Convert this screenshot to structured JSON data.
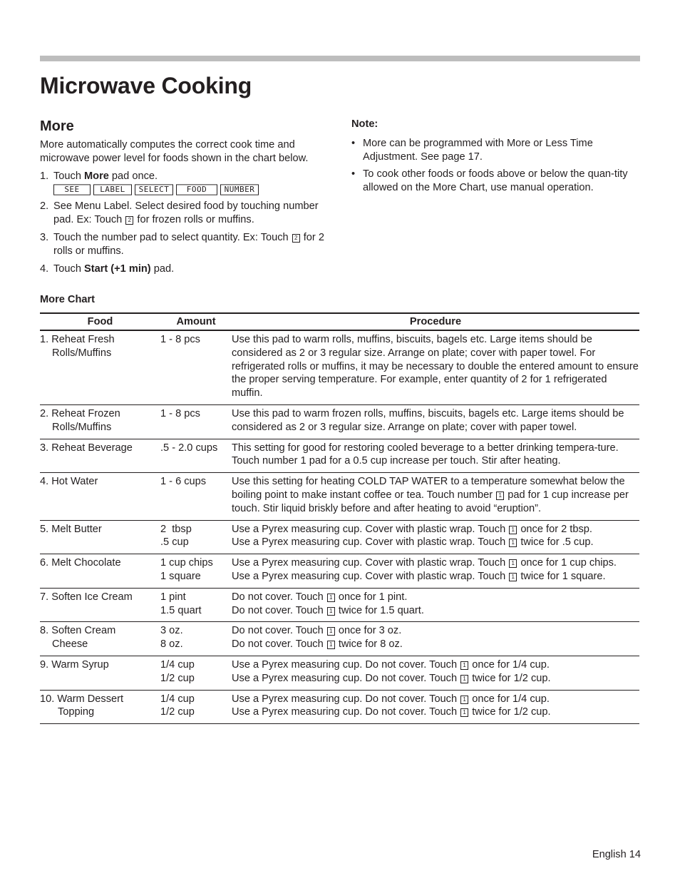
{
  "page": {
    "title": "Microwave Cooking",
    "footer": "English 14"
  },
  "more_section": {
    "title": "More",
    "intro": "More automatically computes the correct cook time and microwave power level for foods shown in the chart below.",
    "steps": [
      {
        "num": "1.",
        "pre": "Touch ",
        "bold": "More",
        "post": " pad once."
      },
      {
        "num": "2.",
        "text_a": "See Menu Label. Select desired food by touching number pad. Ex: Touch ",
        "key": "2",
        "text_b": " for frozen rolls or muffins."
      },
      {
        "num": "3.",
        "text_a": "Touch the number pad to select quantity. Ex: Touch ",
        "key": "2",
        "text_b": " for 2 rolls or muffins."
      },
      {
        "num": "4.",
        "pre": "Touch ",
        "bold": "Start (+1 min)",
        "post": " pad."
      }
    ],
    "display_words": [
      "SEE",
      "LABEL",
      "SELECT",
      "FOOD",
      "NUMBER"
    ]
  },
  "note": {
    "title": "Note:",
    "bullet": "•",
    "items": [
      "More can be programmed with More or Less Time Adjustment. See page 17.",
      "To cook other foods or foods above or below the quan-tity allowed on the More Chart, use manual operation."
    ]
  },
  "chart": {
    "title": "More Chart",
    "headers": {
      "food": "Food",
      "amount": "Amount",
      "procedure": "Procedure"
    },
    "rows": [
      {
        "food": [
          "1. Reheat Fresh",
          "Rolls/Muffins"
        ],
        "amount": [
          "1 - 8 pcs"
        ],
        "procedure": [
          "Use this pad to warm rolls, muffins, biscuits, bagels etc. Large items should be considered as 2 or 3 regular size. Arrange on plate; cover with paper towel. For refrigerated rolls or muffins, it may be necessary to double the entered amount to ensure the proper serving temperature. For example, enter quantity of 2 for 1 refrigerated muffin."
        ]
      },
      {
        "food": [
          "2. Reheat Frozen",
          "Rolls/Muffins"
        ],
        "amount": [
          "1 - 8 pcs"
        ],
        "procedure": [
          "Use this pad to warm frozen rolls, muffins, biscuits, bagels etc. Large items should be considered as 2 or 3 regular size. Arrange on plate; cover with paper towel."
        ]
      },
      {
        "food": [
          "3. Reheat Beverage"
        ],
        "amount": [
          ".5 - 2.0 cups"
        ],
        "procedure": [
          "This setting for good for restoring cooled beverage to a better drinking tempera-ture. Touch number 1 pad for a 0.5 cup increase per touch. Stir after heating."
        ]
      },
      {
        "food": [
          "4. Hot Water"
        ],
        "amount": [
          "1 - 6 cups"
        ],
        "procedure_key": {
          "a": "Use this setting for heating COLD TAP WATER to a temperature somewhat below the boiling point to make instant coffee or tea. Touch number ",
          "key": "1",
          "b": " pad for 1 cup increase per touch. Stir liquid briskly before and after heating to avoid “eruption”."
        }
      },
      {
        "food": [
          "5. Melt Butter"
        ],
        "amount": [
          "2  tbsp",
          ".5 cup"
        ],
        "lines": [
          {
            "a": "Use a Pyrex measuring cup. Cover with plastic wrap. Touch ",
            "key": "1",
            "b": " once for 2 tbsp."
          },
          {
            "a": "Use a Pyrex measuring cup. Cover with plastic wrap. Touch ",
            "key": "1",
            "b": " twice for .5 cup."
          }
        ]
      },
      {
        "food": [
          "6. Melt Chocolate"
        ],
        "amount": [
          "1 cup chips",
          "1 square"
        ],
        "lines": [
          {
            "a": "Use a Pyrex measuring cup. Cover with plastic wrap. Touch ",
            "key": "1",
            "b": " once for 1 cup chips."
          },
          {
            "a": "Use a Pyrex measuring cup. Cover with plastic wrap. Touch ",
            "key": "1",
            "b": " twice for 1 square."
          }
        ]
      },
      {
        "food": [
          "7. Soften Ice Cream"
        ],
        "amount": [
          "1 pint",
          "1.5 quart"
        ],
        "lines": [
          {
            "a": "Do not cover. Touch ",
            "key": "1",
            "b": " once for 1 pint."
          },
          {
            "a": "Do not cover. Touch ",
            "key": "1",
            "b": " twice for 1.5 quart."
          }
        ]
      },
      {
        "food": [
          "8. Soften Cream",
          "Cheese"
        ],
        "amount": [
          "3 oz.",
          "8 oz."
        ],
        "lines": [
          {
            "a": "Do not cover. Touch ",
            "key": "1",
            "b": " once for 3 oz."
          },
          {
            "a": "Do not cover. Touch ",
            "key": "1",
            "b": " twice for 8 oz."
          }
        ]
      },
      {
        "food": [
          "9. Warm Syrup"
        ],
        "amount": [
          "1/4 cup",
          "1/2 cup"
        ],
        "lines": [
          {
            "a": "Use a Pyrex measuring cup. Do not cover. Touch ",
            "key": "1",
            "b": " once for 1/4 cup."
          },
          {
            "a": "Use a Pyrex measuring cup. Do not cover. Touch ",
            "key": "1",
            "b": " twice for 1/2 cup."
          }
        ]
      },
      {
        "food": [
          "10. Warm Dessert",
          "Topping"
        ],
        "amount": [
          "1/4 cup",
          "1/2 cup"
        ],
        "lines": [
          {
            "a": "Use a Pyrex measuring cup. Do not cover. Touch ",
            "key": "1",
            "b": " once for 1/4 cup."
          },
          {
            "a": "Use a Pyrex measuring cup. Do not cover. Touch ",
            "key": "1",
            "b": " twice for 1/2 cup."
          }
        ]
      }
    ]
  }
}
